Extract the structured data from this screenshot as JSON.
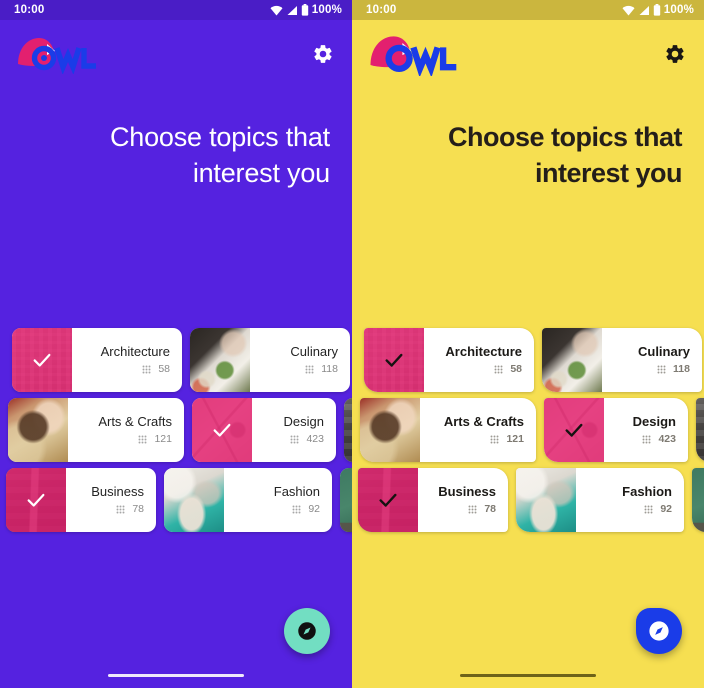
{
  "app": {
    "name": "OWL",
    "logo_icon": "owl-logo-icon"
  },
  "panels": [
    {
      "id": "baseline",
      "theme_name": "purple",
      "colors": {
        "background": "#5522E0",
        "statusbar": "#4A1DC6",
        "headline_text": "#FFFFFF",
        "accent_selected": "#E3206F",
        "fab": "#72DEC2",
        "fab_icon": "#101010",
        "logo_mark": "#E3206F",
        "logo_word": "#1A3CE8"
      },
      "status_bar": {
        "time": "10:00",
        "wifi_icon": "wifi-icon",
        "signal_icon": "cellular-signal-icon",
        "battery_icon": "battery-full-icon",
        "battery_percent": "100%"
      },
      "app_bar": {
        "logo_label": "OWL",
        "settings_icon": "gear-icon"
      },
      "headline": "Choose topics that interest you",
      "fab": {
        "icon": "compass-explore-icon",
        "label": "Explore"
      },
      "home_indicator": "home-indicator"
    },
    {
      "id": "themed",
      "theme_name": "yellow",
      "colors": {
        "background": "#F6DF51",
        "statusbar": "#CBB63E",
        "headline_text": "#241E1A",
        "accent_selected": "#E3206F",
        "fab": "#1A3CE8",
        "fab_icon": "#FFFFFF",
        "logo_mark": "#E3206F",
        "logo_word": "#1A3CE8"
      },
      "status_bar": {
        "time": "10:00",
        "wifi_icon": "wifi-icon",
        "signal_icon": "cellular-signal-icon",
        "battery_icon": "battery-full-icon",
        "battery_percent": "100%"
      },
      "app_bar": {
        "logo_label": "OWL",
        "settings_icon": "gear-icon"
      },
      "headline": "Choose topics that interest you",
      "fab": {
        "icon": "compass-explore-icon",
        "label": "Explore"
      },
      "home_indicator": "home-indicator"
    }
  ],
  "topics": {
    "count_icon": "grain-icon",
    "check_icon": "check-icon",
    "rows": [
      [
        {
          "name": "Architecture",
          "count": "58",
          "selected": true,
          "thumb": "architecture-thumb"
        },
        {
          "name": "Culinary",
          "count": "118",
          "selected": false,
          "thumb": "culinary-thumb"
        },
        {
          "name": "",
          "count": "",
          "selected": false,
          "thumb": "offscreen-thumb"
        }
      ],
      [
        {
          "name": "Arts & Crafts",
          "count": "121",
          "selected": false,
          "thumb": "arts-crafts-thumb"
        },
        {
          "name": "Design",
          "count": "423",
          "selected": true,
          "thumb": "design-thumb"
        },
        {
          "name": "",
          "count": "",
          "selected": false,
          "thumb": "offscreen-thumb"
        }
      ],
      [
        {
          "name": "Business",
          "count": "78",
          "selected": true,
          "thumb": "business-thumb"
        },
        {
          "name": "Fashion",
          "count": "92",
          "selected": false,
          "thumb": "fashion-thumb"
        },
        {
          "name": "",
          "count": "",
          "selected": false,
          "thumb": "offscreen-thumb"
        }
      ]
    ]
  }
}
